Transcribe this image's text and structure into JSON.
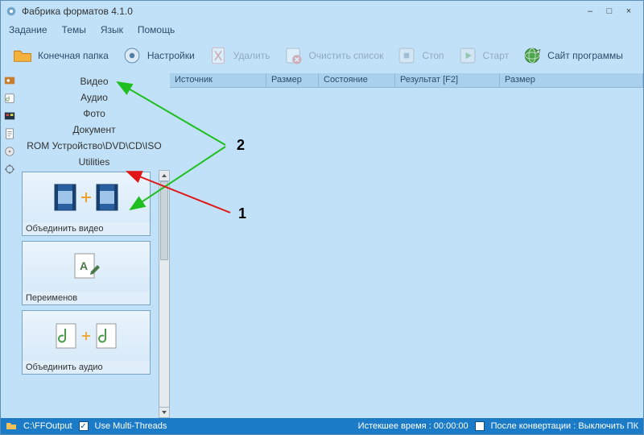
{
  "window": {
    "title": "Фабрика форматов 4.1.0"
  },
  "menu": {
    "task": "Задание",
    "themes": "Темы",
    "language": "Язык",
    "help": "Помощь"
  },
  "toolbar": {
    "output_folder": "Конечная папка",
    "settings": "Настройки",
    "delete": "Удалить",
    "clear_list": "Очистить список",
    "stop": "Стоп",
    "start": "Старт",
    "website": "Сайт программы"
  },
  "categories": {
    "video": "Видео",
    "audio": "Аудио",
    "photo": "Фото",
    "document": "Документ",
    "rom": "ROM Устройство\\DVD\\CD\\ISO",
    "utilities": "Utilities"
  },
  "thumbs": {
    "join_video": "Объединить видео",
    "rename": "Переименов",
    "join_audio": "Объединить аудио"
  },
  "columns": {
    "source": "Источник",
    "size1": "Размер",
    "state": "Состояние",
    "result": "Результат [F2]",
    "size2": "Размер"
  },
  "status": {
    "output_path": "C:\\FFOutput",
    "multithreads": "Use Multi-Threads",
    "elapsed": "Истекшее время : 00:00:00",
    "after_conv": "После конвертации : Выключить ПК"
  },
  "annotations": {
    "one": "1",
    "two": "2"
  }
}
